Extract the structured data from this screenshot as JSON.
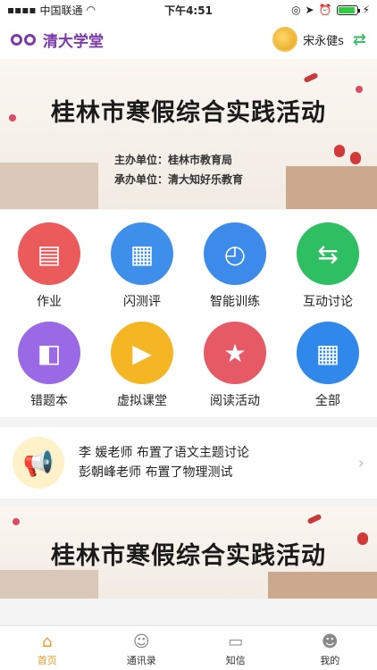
{
  "status": {
    "carrier": "中国联通",
    "time": "下午4:51"
  },
  "header": {
    "brand": "清大学堂",
    "username": "宋永健s"
  },
  "banner1": {
    "title": "桂林市寒假综合实践活动",
    "organizer": "主办单位：桂林市教育局",
    "co_organizer": "承办单位：清大知好乐教育"
  },
  "grid": [
    {
      "label": "作业",
      "icon": "homework-icon",
      "color": "#ec5b5b"
    },
    {
      "label": "闪测评",
      "icon": "chart-icon",
      "color": "#3e8fe9"
    },
    {
      "label": "智能训练",
      "icon": "stopwatch-icon",
      "color": "#3c8bea"
    },
    {
      "label": "互动讨论",
      "icon": "chat-icon",
      "color": "#2fbf63"
    },
    {
      "label": "错题本",
      "icon": "book-icon",
      "color": "#9a6ae6"
    },
    {
      "label": "虚拟课堂",
      "icon": "tv-icon",
      "color": "#f5b623"
    },
    {
      "label": "阅读活动",
      "icon": "flag-icon",
      "color": "#e65a66"
    },
    {
      "label": "全部",
      "icon": "grid-icon",
      "color": "#2f88ea"
    }
  ],
  "notice": {
    "line1": "李  媛老师 布置了语文主题讨论",
    "line2": "彭朝峰老师 布置了物理测试"
  },
  "banner2": {
    "title": "桂林市寒假综合实践活动"
  },
  "tabs": [
    {
      "label": "首页",
      "icon": "home-icon"
    },
    {
      "label": "通讯录",
      "icon": "contacts-icon"
    },
    {
      "label": "知信",
      "icon": "message-icon"
    },
    {
      "label": "我的",
      "icon": "profile-icon"
    }
  ]
}
